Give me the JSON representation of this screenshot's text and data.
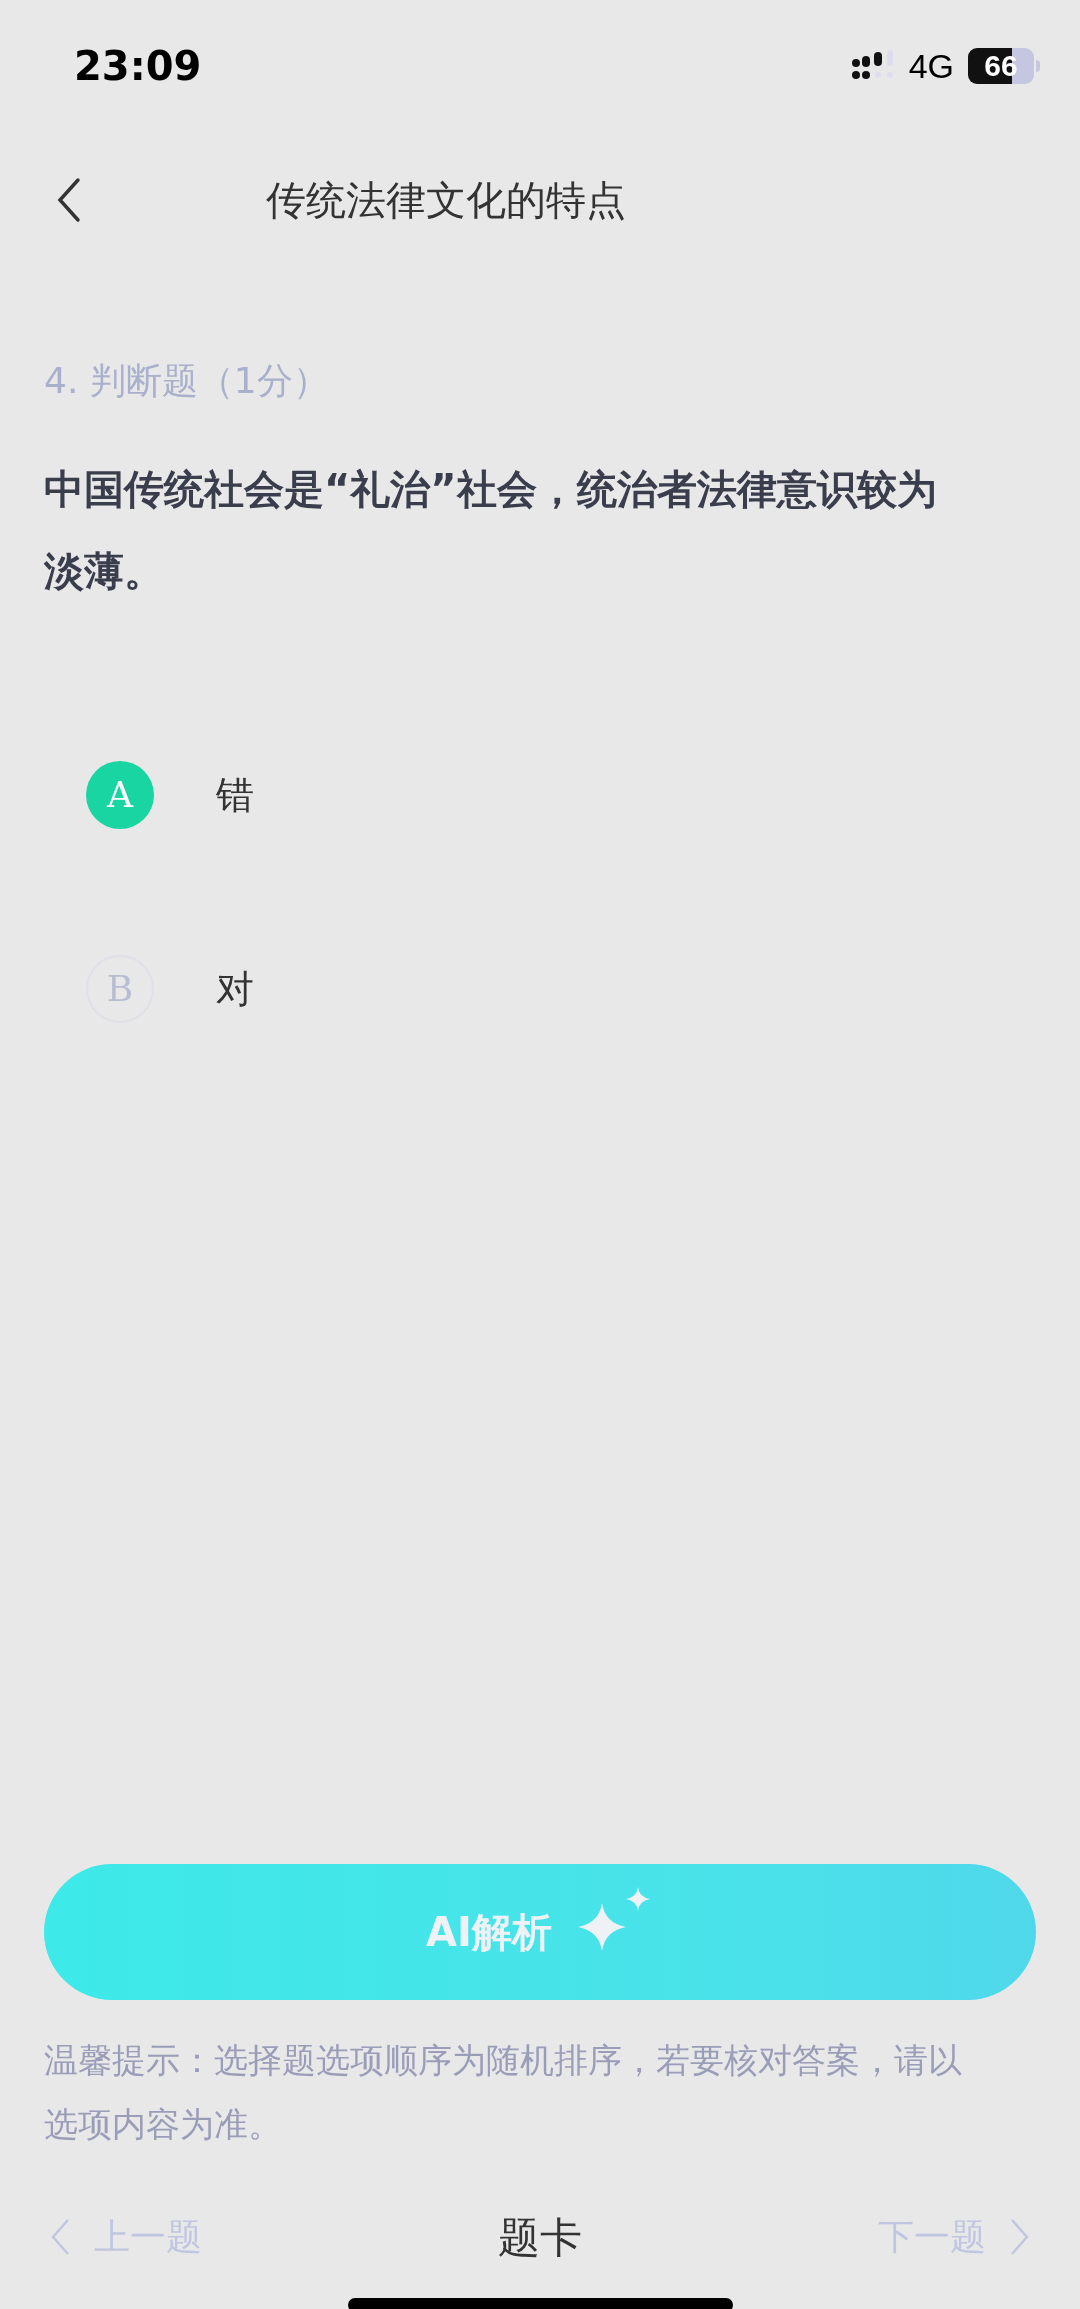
{
  "status_bar": {
    "time": "23:09",
    "network": "4G",
    "battery": "66"
  },
  "header": {
    "title": "传统法律文化的特点"
  },
  "question": {
    "type": "4. 判断题（1分）",
    "text": "中国传统社会是“礼治”社会，统治者法律意识较为淡薄。"
  },
  "options": [
    {
      "letter": "A",
      "label": "错",
      "selected": true
    },
    {
      "letter": "B",
      "label": "对",
      "selected": false
    }
  ],
  "ai_button": {
    "label": "AI解析"
  },
  "hint": "温馨提示：选择题选项顺序为随机排序，若要核对答案，请以选项内容为准。",
  "nav": {
    "prev": "上一题",
    "card": "题卡",
    "next": "下一题"
  }
}
